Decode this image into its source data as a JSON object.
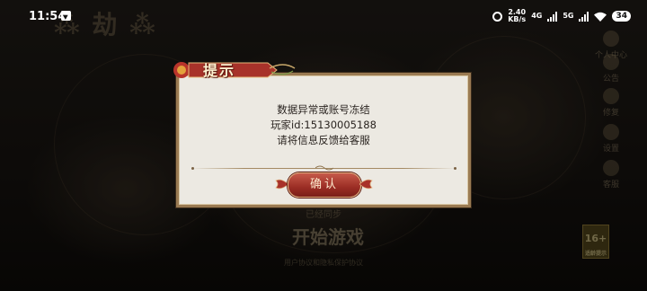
{
  "status_bar": {
    "time": "11:54",
    "speed_value": "2.40",
    "speed_unit": "KB/s",
    "net1": "4G",
    "net2": "5G",
    "battery": "34"
  },
  "background": {
    "start_label": "开始游戏",
    "notice_label": "用户协议和隐私保护协议",
    "faint_label": "已经同步",
    "side_menu": [
      "个人中心",
      "公告",
      "修复",
      "设置",
      "客服"
    ],
    "age_badge": "16+",
    "age_badge_sub": "适龄提示"
  },
  "dialog": {
    "title": "提示",
    "lines": [
      "数据异常或账号冻结",
      "玩家id:15130005188",
      "请将信息反馈给客服"
    ],
    "confirm_label": "确认"
  },
  "colors": {
    "dialog_bg": "#ece9e2",
    "dialog_border": "#9a7a52",
    "button_red": "#9b2d24",
    "title_banner_red": "#a8322a"
  }
}
